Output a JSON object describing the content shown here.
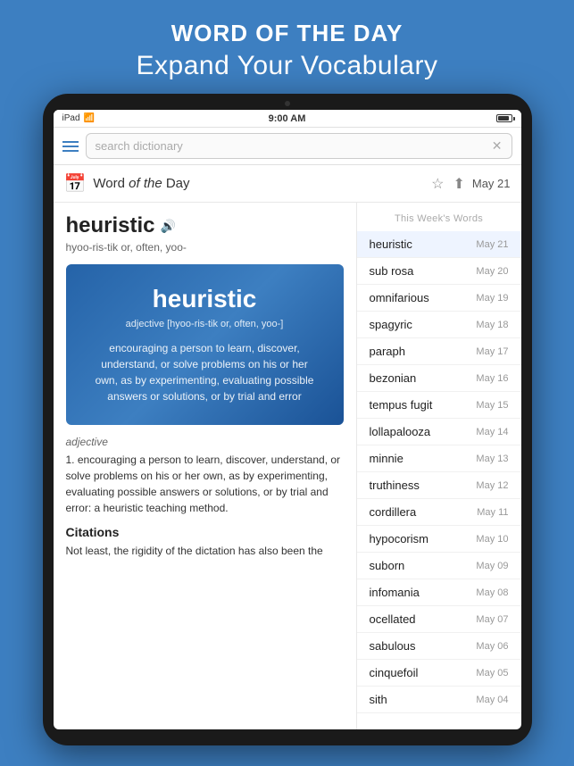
{
  "promo": {
    "title": "WORD OF THE DAY",
    "subtitle": "Expand Your Vocabulary"
  },
  "status_bar": {
    "device": "iPad",
    "wifi": "WiFi",
    "time": "9:00 AM"
  },
  "search": {
    "placeholder": "search dictionary"
  },
  "header": {
    "icon": "📅",
    "title_bold": "Word",
    "title_italic": "of the",
    "title_end": "Day",
    "date": "May 21",
    "star_label": "★",
    "share_label": "⬆"
  },
  "word": {
    "title": "heuristic",
    "speaker": "🔊",
    "pronunciation": "hyoo-ris-tik or, often, yoo-",
    "card_word_start": "heu",
    "card_word_bold": "ris",
    "card_word_end": "tic",
    "card_pronunciation": "adjective [hyoo-ris-tik or, often, yoo-]",
    "card_definition": "encouraging a person to learn, discover, understand, or solve problems on his or her own, as by experimenting, evaluating possible answers or solutions, or by trial and error",
    "part_of_speech": "adjective",
    "definition": "1. encouraging a person to learn, discover, understand, or solve problems on his or her own, as by experimenting, evaluating possible answers or solutions, or by trial and error: a heuristic teaching method.",
    "citations_title": "Citations",
    "citation": "Not least, the rigidity of the dictation has also been the"
  },
  "week_header": "This Week's Words",
  "word_list": [
    {
      "word": "heuristic",
      "date": "May 21",
      "active": true
    },
    {
      "word": "sub rosa",
      "date": "May 20"
    },
    {
      "word": "omnifarious",
      "date": "May 19"
    },
    {
      "word": "spagyric",
      "date": "May 18"
    },
    {
      "word": "paraph",
      "date": "May 17"
    },
    {
      "word": "bezonian",
      "date": "May 16"
    },
    {
      "word": "tempus fugit",
      "date": "May 15"
    },
    {
      "word": "lollapalooza",
      "date": "May 14"
    },
    {
      "word": "minnie",
      "date": "May 13"
    },
    {
      "word": "truthiness",
      "date": "May 12"
    },
    {
      "word": "cordillera",
      "date": "May 11"
    },
    {
      "word": "hypocorism",
      "date": "May 10"
    },
    {
      "word": "suborn",
      "date": "May 09"
    },
    {
      "word": "infomania",
      "date": "May 08"
    },
    {
      "word": "ocellated",
      "date": "May 07"
    },
    {
      "word": "sabulous",
      "date": "May 06"
    },
    {
      "word": "cinquefoil",
      "date": "May 05"
    },
    {
      "word": "sith",
      "date": "May 04"
    }
  ]
}
